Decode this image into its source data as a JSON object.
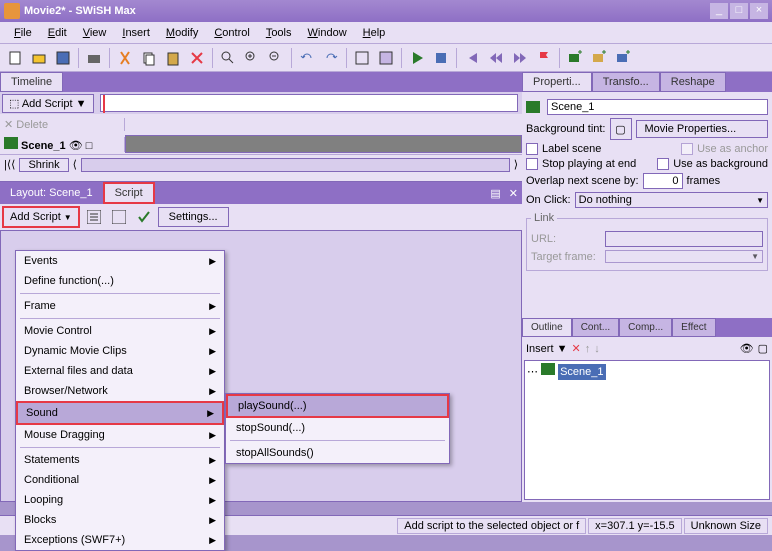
{
  "window": {
    "title": "Movie2* - SWiSH Max"
  },
  "menubar": [
    "File",
    "Edit",
    "View",
    "Insert",
    "Modify",
    "Control",
    "Tools",
    "Window",
    "Help"
  ],
  "timeline": {
    "tab": "Timeline",
    "add_script": "Add Script",
    "delete": "Delete",
    "scene_name": "Scene_1",
    "shrink": "Shrink"
  },
  "layout": {
    "layout_label": "Layout: Scene_1",
    "script_label": "Script",
    "add_script": "Add Script",
    "settings": "Settings..."
  },
  "context_menu": {
    "events": "Events",
    "define_fn": "Define function(...)",
    "frame": "Frame",
    "movie_control": "Movie Control",
    "dynamic_clips": "Dynamic Movie Clips",
    "external": "External files and data",
    "browser": "Browser/Network",
    "sound": "Sound",
    "mouse": "Mouse Dragging",
    "statements": "Statements",
    "conditional": "Conditional",
    "looping": "Looping",
    "blocks": "Blocks",
    "exceptions": "Exceptions (SWF7+)"
  },
  "submenu": {
    "play": "playSound(...)",
    "stop": "stopSound(...)",
    "stop_all": "stopAllSounds()"
  },
  "properties": {
    "tabs": [
      "Properti...",
      "Transfo...",
      "Reshape"
    ],
    "scene_name": "Scene_1",
    "bg_tint": "Background tint:",
    "movie_props": "Movie Properties...",
    "label_scene": "Label scene",
    "use_anchor": "Use as anchor",
    "stop_playing": "Stop playing at end",
    "use_bg": "Use as background",
    "overlap": "Overlap next scene by:",
    "overlap_val": "0",
    "frames": "frames",
    "on_click": "On Click:",
    "on_click_val": "Do nothing",
    "link_label": "Link",
    "url": "URL:",
    "target": "Target frame:"
  },
  "outline": {
    "tabs": [
      "Outline",
      "Cont...",
      "Comp...",
      "Effect"
    ],
    "insert": "Insert",
    "scene": "Scene_1"
  },
  "status": {
    "text": "Add script to the selected object or f",
    "coords": "x=307.1 y=-15.5",
    "size": "Unknown Size"
  }
}
